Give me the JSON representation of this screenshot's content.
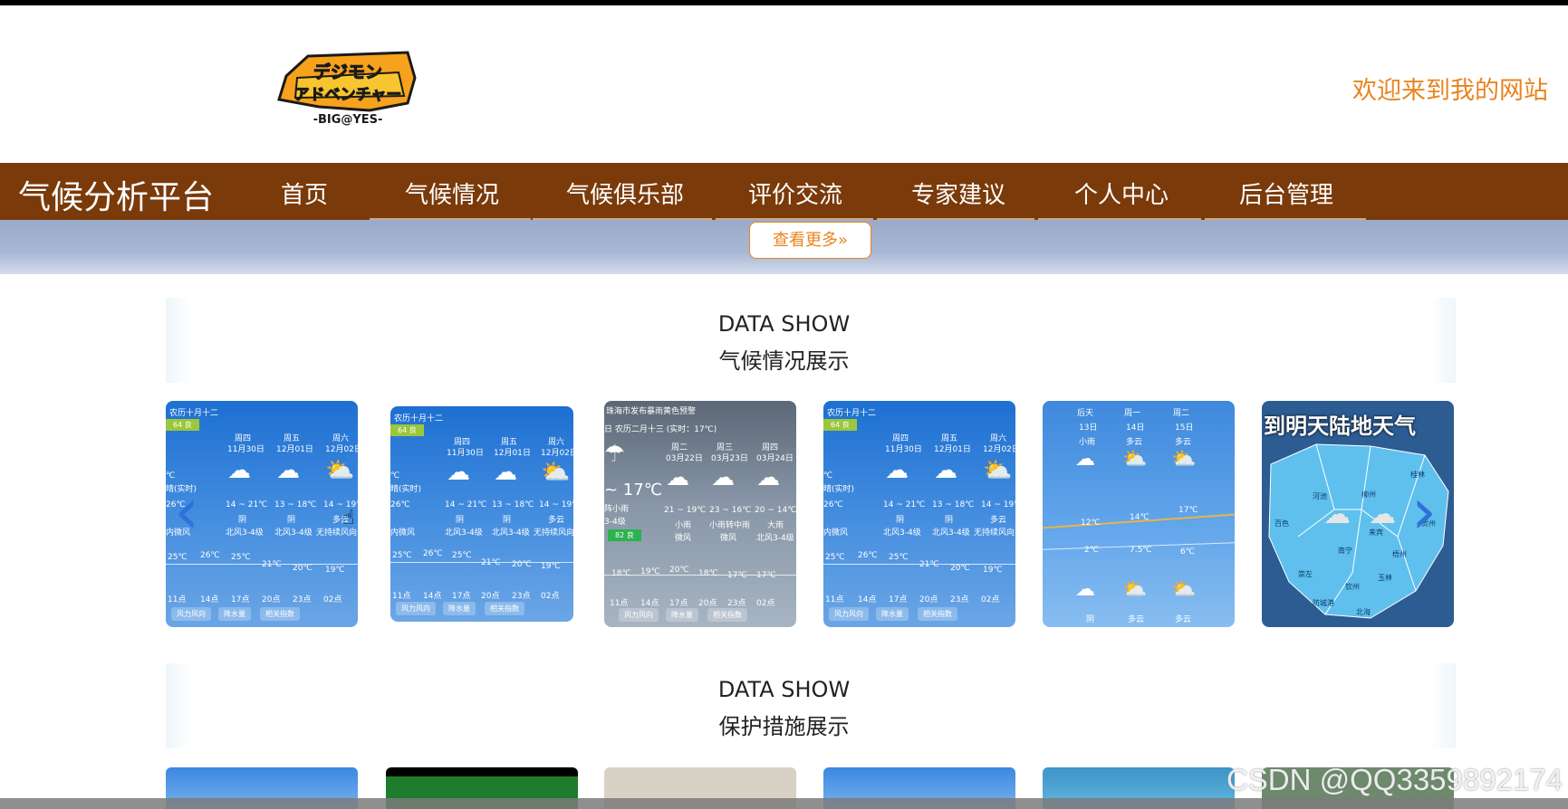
{
  "header": {
    "logo_text_top": "デジモン",
    "logo_text_mid": "アドベンチャー",
    "logo_text_sub": "-BIG@YES-",
    "welcome": "欢迎来到我的网站"
  },
  "nav": {
    "brand": "气候分析平台",
    "items": [
      "首页",
      "气候情况",
      "气候俱乐部",
      "评价交流",
      "专家建议",
      "个人中心",
      "后台管理"
    ]
  },
  "banner": {
    "more_button": "查看更多»"
  },
  "sections": [
    {
      "title_en": "DATA SHOW",
      "title_cn": "气候情况展示"
    },
    {
      "title_en": "DATA SHOW",
      "title_cn": "保护措施展示"
    }
  ],
  "carousel": {
    "prev_icon": "chevron-left-icon",
    "next_icon": "chevron-right-icon",
    "cards": [
      {
        "lunar": "农历十月十二",
        "aqi": "64 良",
        "days": [
          "周四",
          "周五",
          "周六"
        ],
        "dates": [
          "11月30日",
          "12月01日",
          "12月02日"
        ],
        "temps": [
          "14 ~ 21℃",
          "13 ~ 18℃",
          "14 ~ 19℃"
        ],
        "conds": [
          "阴",
          "阴",
          "多云"
        ],
        "winds": [
          "北风3-4级",
          "北风3-4级",
          "无持续风向"
        ],
        "side": [
          "℃",
          "晴(实时)",
          "26℃",
          "内微风"
        ],
        "points": [
          "25℃",
          "26℃",
          "25℃",
          "21℃",
          "20℃",
          "19℃"
        ],
        "hours": [
          "11点",
          "14点",
          "17点",
          "20点",
          "23点",
          "02点"
        ],
        "tabs": [
          "风力风向",
          "降水量",
          "相关指数"
        ]
      },
      {
        "lunar": "农历十月十二",
        "aqi": "64 良",
        "days": [
          "周四",
          "周五",
          "周六"
        ],
        "dates": [
          "11月30日",
          "12月01日",
          "12月02日"
        ],
        "temps": [
          "14 ~ 21℃",
          "13 ~ 18℃",
          "14 ~ 19℃"
        ],
        "conds": [
          "阴",
          "阴",
          "多云"
        ],
        "winds": [
          "北风3-4级",
          "北风3-4级",
          "无持续风向"
        ],
        "side": [
          "℃",
          "晴(实时)",
          "26℃",
          "内微风"
        ],
        "points": [
          "25℃",
          "26℃",
          "25℃",
          "21℃",
          "20℃",
          "19℃"
        ],
        "hours": [
          "11点",
          "14点",
          "17点",
          "20点",
          "23点",
          "02点"
        ],
        "tabs": [
          "风力风向",
          "降水量",
          "相关指数"
        ]
      },
      {
        "alert": "珠海市发布暴雨黄色预警",
        "lunar": "日 农历二月十三 (实时：17℃)",
        "big_temp": "~ 17℃",
        "aqi": "82 良",
        "side": [
          "阵小雨",
          "3-4级"
        ],
        "days": [
          "周二",
          "周三",
          "周四"
        ],
        "dates": [
          "03月22日",
          "03月23日",
          "03月24日"
        ],
        "temps": [
          "21 ~ 19℃",
          "23 ~ 16℃",
          "20 ~ 14℃"
        ],
        "conds": [
          "小雨",
          "小雨转中雨",
          "大雨"
        ],
        "winds": [
          "微风",
          "微风",
          "北风3-4级"
        ],
        "points": [
          "18℃",
          "19℃",
          "20℃",
          "18℃",
          "17℃",
          "17℃"
        ],
        "hours": [
          "11点",
          "14点",
          "17点",
          "20点",
          "23点",
          "02点"
        ],
        "tabs": [
          "风力风向",
          "降水量",
          "相关指数"
        ]
      },
      {
        "lunar": "农历十月十二",
        "aqi": "64 良",
        "days": [
          "周四",
          "周五",
          "周六"
        ],
        "dates": [
          "11月30日",
          "12月01日",
          "12月02日"
        ],
        "temps": [
          "14 ~ 21℃",
          "13 ~ 18℃",
          "14 ~ 19℃"
        ],
        "conds": [
          "阴",
          "阴",
          "多云"
        ],
        "winds": [
          "北风3-4级",
          "北风3-4级",
          "无持续风向"
        ],
        "side": [
          "℃",
          "晴(实时)",
          "26℃",
          "内微风"
        ],
        "points": [
          "25℃",
          "26℃",
          "25℃",
          "21℃",
          "20℃",
          "19℃"
        ],
        "hours": [
          "11点",
          "14点",
          "17点",
          "20点",
          "23点",
          "02点"
        ],
        "tabs": [
          "风力风向",
          "降水量",
          "相关指数"
        ]
      },
      {
        "days": [
          "后天",
          "周一",
          "周二"
        ],
        "dates": [
          "13日",
          "14日",
          "15日"
        ],
        "top_conds": [
          "小雨",
          "多云",
          "多云"
        ],
        "high": [
          "12℃",
          "14℃",
          "17℃"
        ],
        "low": [
          "2℃",
          "7.5℃",
          "6℃"
        ],
        "bottom_conds": [
          "阴",
          "多云",
          "多云"
        ]
      },
      {
        "headline": "到明天陆地天气",
        "cities": [
          "河池",
          "柳州",
          "桂林",
          "百色",
          "南宁",
          "来宾",
          "贺州",
          "梧州",
          "崇左",
          "钦州",
          "玉林",
          "防城港",
          "北海"
        ]
      }
    ]
  },
  "watermark": "CSDN @QQ3359892174",
  "colors": {
    "nav_bg": "#7a3a0a",
    "accent": "#e8841f",
    "carousel_arrow": "#2e72d8"
  }
}
